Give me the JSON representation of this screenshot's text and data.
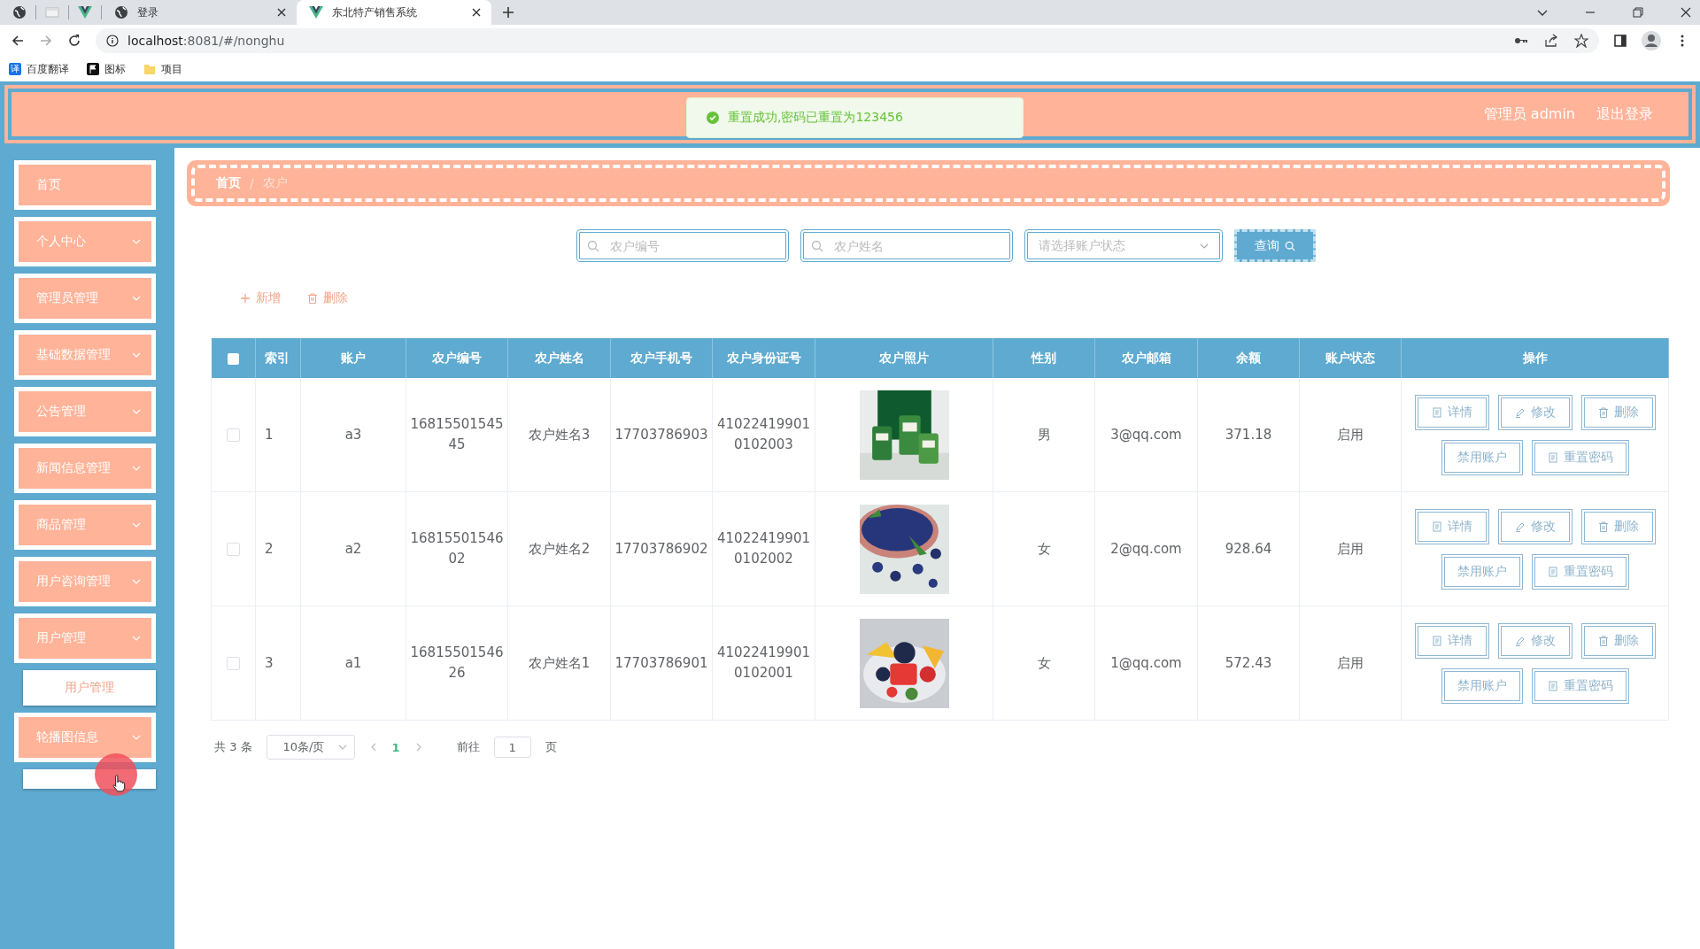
{
  "browser": {
    "tabs": [
      {
        "kind": "globe",
        "title": "登录",
        "selected": false
      },
      {
        "kind": "vue",
        "title": "东北特产销售系统",
        "selected": true
      }
    ],
    "url_host": "localhost",
    "url_rest": ":8081/#/nonghu",
    "bookmarks": [
      {
        "kind": "translate",
        "icon_text": "译",
        "label": "百度翻译"
      },
      {
        "kind": "flag",
        "label": "图标"
      },
      {
        "kind": "folder",
        "label": "项目"
      }
    ]
  },
  "header": {
    "toast": "重置成功,密码已重置为123456",
    "user": "管理员 admin",
    "logout": "退出登录"
  },
  "sidebar": {
    "items": [
      {
        "label": "首页",
        "has_children": false
      },
      {
        "label": "个人中心",
        "has_children": true
      },
      {
        "label": "管理员管理",
        "has_children": true
      },
      {
        "label": "基础数据管理",
        "has_children": true
      },
      {
        "label": "公告管理",
        "has_children": true
      },
      {
        "label": "新闻信息管理",
        "has_children": true
      },
      {
        "label": "商品管理",
        "has_children": true
      },
      {
        "label": "用户咨询管理",
        "has_children": true
      },
      {
        "label": "用户管理",
        "has_children": true,
        "children": [
          {
            "label": "用户管理",
            "covered": false
          }
        ]
      },
      {
        "label": "轮播图信息",
        "has_children": true,
        "children": [
          {
            "covered": true
          }
        ]
      }
    ]
  },
  "breadcrumb": [
    {
      "label": "首页",
      "selected": false
    },
    {
      "separator": "/",
      "label": "农户",
      "selected": true
    }
  ],
  "search": {
    "fields": [
      {
        "placeholder": "农户编号"
      },
      {
        "placeholder": "农户姓名"
      }
    ],
    "select_placeholder": "请选择账户状态",
    "button": "查询"
  },
  "actions": [
    {
      "kind": "add",
      "label": "新增"
    },
    {
      "kind": "delete",
      "label": "删除"
    }
  ],
  "table": {
    "select_all_checked": false,
    "columns": [
      "索引",
      "账户",
      "农户编号",
      "农户姓名",
      "农户手机号",
      "农户身份证号",
      "农户照片",
      "性别",
      "农户邮箱",
      "余额",
      "账户状态",
      "操作"
    ],
    "rows": [
      {
        "checked": false,
        "index": "1",
        "account": "a3",
        "number": "1681550154545",
        "name": "农户姓名3",
        "phone": "17703786903",
        "id_card": "410224199010102003",
        "gender": "男",
        "email": "3@qq.com",
        "balance": "371.18",
        "status": "启用",
        "buttons": [
          {
            "kind": "doc",
            "label": "详情"
          },
          {
            "kind": "pen",
            "label": "修改"
          },
          {
            "kind": "trash",
            "label": "删除"
          },
          {
            "kind": "none",
            "label": "禁用账户"
          },
          {
            "kind": "doc",
            "label": "重置密码"
          }
        ]
      },
      {
        "checked": false,
        "index": "2",
        "account": "a2",
        "number": "1681550154602",
        "name": "农户姓名2",
        "phone": "17703786902",
        "id_card": "410224199010102002",
        "gender": "女",
        "email": "2@qq.com",
        "balance": "928.64",
        "status": "启用",
        "buttons": [
          {
            "kind": "doc",
            "label": "详情"
          },
          {
            "kind": "pen",
            "label": "修改"
          },
          {
            "kind": "trash",
            "label": "删除"
          },
          {
            "kind": "none",
            "label": "禁用账户"
          },
          {
            "kind": "doc",
            "label": "重置密码"
          }
        ]
      },
      {
        "checked": false,
        "index": "3",
        "account": "a1",
        "number": "1681550154626",
        "name": "农户姓名1",
        "phone": "17703786901",
        "id_card": "410224199010102001",
        "gender": "女",
        "email": "1@qq.com",
        "balance": "572.43",
        "status": "启用",
        "buttons": [
          {
            "kind": "doc",
            "label": "详情"
          },
          {
            "kind": "pen",
            "label": "修改"
          },
          {
            "kind": "trash",
            "label": "删除"
          },
          {
            "kind": "none",
            "label": "禁用账户"
          },
          {
            "kind": "doc",
            "label": "重置密码"
          }
        ]
      }
    ]
  },
  "pagination": {
    "total": "共 3 条",
    "page_size": "10条/页",
    "pages": [
      {
        "label": "1",
        "selected": true
      }
    ],
    "goto": "前往",
    "goto_value": "1",
    "suffix": "页"
  }
}
